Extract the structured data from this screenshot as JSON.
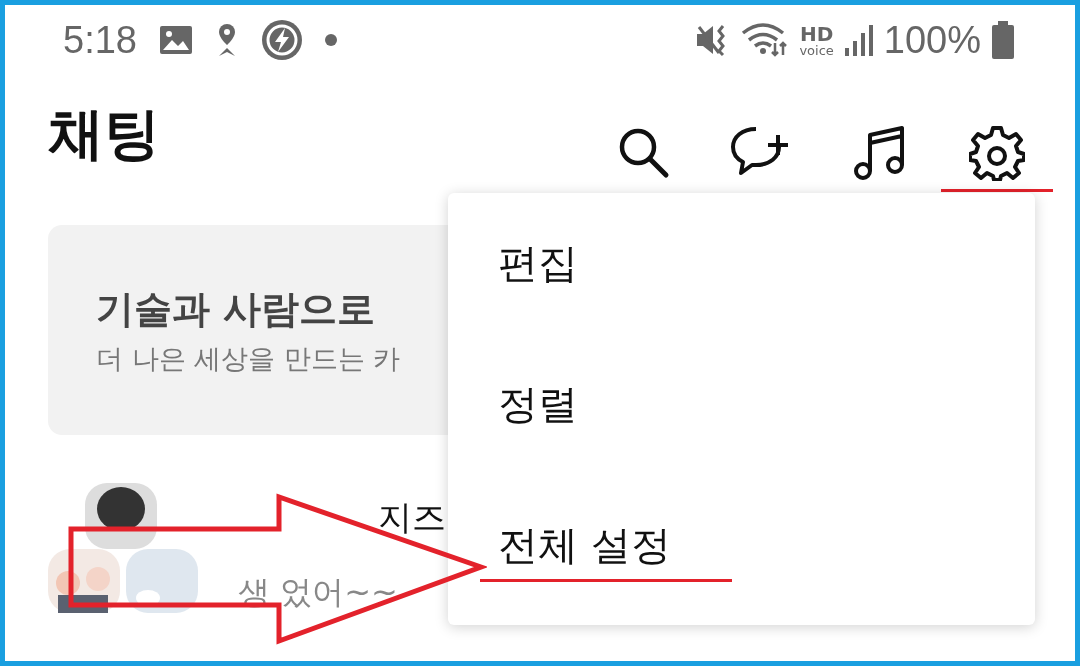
{
  "status_bar": {
    "time": "5:18",
    "hd_label": "HD",
    "voice_label": "voice",
    "battery": "100%"
  },
  "header": {
    "title": "채팅",
    "actions": [
      {
        "kind": "search",
        "marked": false
      },
      {
        "kind": "new-chat",
        "marked": false
      },
      {
        "kind": "music",
        "marked": false
      },
      {
        "kind": "settings",
        "marked": true
      }
    ]
  },
  "banner": {
    "title": "기술과 사람으로",
    "subtitle": "더 나은 세상을 만드는 카"
  },
  "chats": [
    {
      "name": "지즈",
      "preview": "생 었어~~"
    }
  ],
  "menu": {
    "items": [
      {
        "label": "편집",
        "marked": false
      },
      {
        "label": "정렬",
        "marked": false
      },
      {
        "label": "전체 설정",
        "marked": true
      }
    ]
  }
}
